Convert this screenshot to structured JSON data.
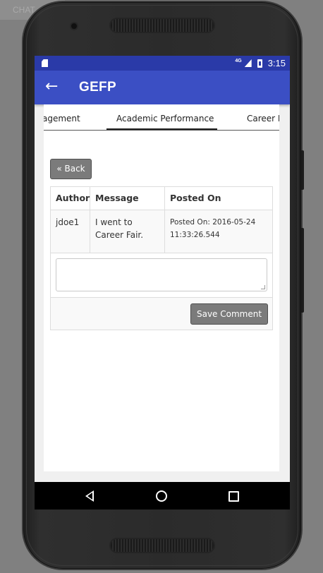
{
  "overlay": {
    "corner_label": "CHAT"
  },
  "status_bar": {
    "network": "4G",
    "time": "3:15"
  },
  "app_bar": {
    "title": "GEFP"
  },
  "tabs": [
    {
      "label": "agement"
    },
    {
      "label": "Academic Performance",
      "active": true
    },
    {
      "label": "Career F"
    }
  ],
  "back_button": {
    "label": "« Back"
  },
  "table": {
    "headers": [
      "Author",
      "Message",
      "Posted On"
    ],
    "rows": [
      {
        "author": "jdoe1",
        "message": "I went to Career Fair.",
        "posted_on": "Posted On: 2016-05-24 11:33:26.544"
      }
    ]
  },
  "comment_box": {
    "placeholder": ""
  },
  "save_button": {
    "label": "Save Comment"
  },
  "colors": {
    "status_bar": "#2a3aa8",
    "app_bar": "#3b4fc4",
    "button": "#7b7b7b"
  },
  "icons": {
    "app_back": "arrow-left-icon",
    "nav_back": "triangle-back-icon",
    "nav_home": "circle-home-icon",
    "nav_recent": "square-recent-icon"
  }
}
